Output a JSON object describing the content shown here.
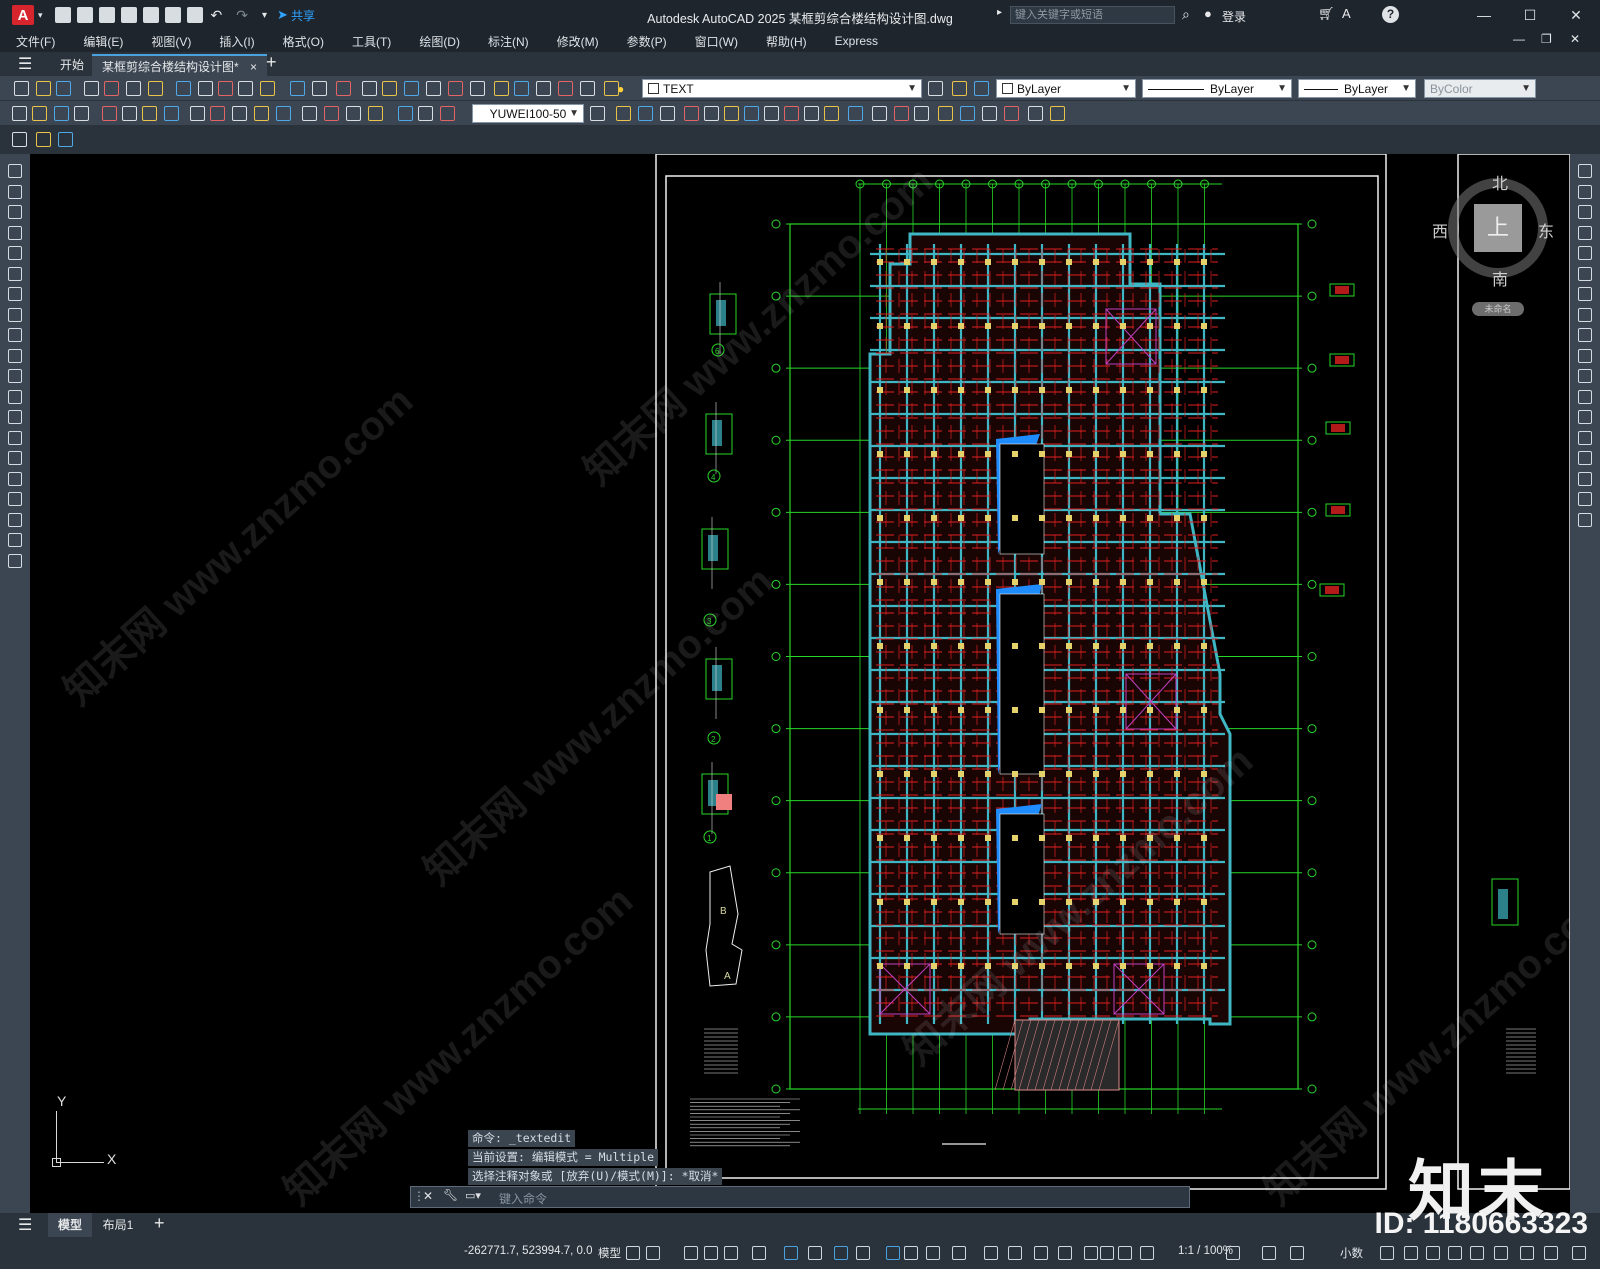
{
  "window": {
    "title": "Autodesk AutoCAD 2025    某框剪综合楼结构设计图.dwg",
    "share_label": "共享",
    "search_placeholder": "键入关键字或短语",
    "login_label": "登录",
    "app_icon_letter": "A"
  },
  "menubar": [
    "文件(F)",
    "编辑(E)",
    "视图(V)",
    "插入(I)",
    "格式(O)",
    "工具(T)",
    "绘图(D)",
    "标注(N)",
    "修改(M)",
    "参数(P)",
    "窗口(W)",
    "帮助(H)",
    "Express"
  ],
  "tabs": {
    "start": "开始",
    "active": "某框剪综合楼结构设计图*",
    "close_glyph": "×",
    "new_glyph": "+"
  },
  "toolbar1": {
    "layer_name": "TEXT",
    "color": "ByLayer",
    "linetype": "ByLayer",
    "lineweight": "ByLayer",
    "plotstyle": "ByColor"
  },
  "toolbar2": {
    "dimstyle": "YUWEI100-50"
  },
  "viewcube": {
    "north": "北",
    "south": "南",
    "east": "东",
    "west": "西",
    "top": "上",
    "wcs": "未命名"
  },
  "ucs": {
    "y": "Y",
    "x": "X"
  },
  "command": {
    "history": [
      "命令: _textedit",
      "当前设置: 编辑模式 = Multiple",
      "选择注释对象或 [放弃(U)/模式(M)]: *取消*"
    ],
    "input_placeholder": "键入命令"
  },
  "layout_tabs": [
    "模型",
    "布局1"
  ],
  "statusbar": {
    "coords": "-262771.7, 523994.7, 0.0",
    "space": "模型",
    "scale": "1:1 / 100%",
    "units": "小数"
  },
  "drawing": {
    "label_a": "A",
    "label_b": "B",
    "detail_numbers": [
      "6",
      "4",
      "3",
      "2",
      "1"
    ]
  },
  "overlay": {
    "id": "ID: 1180663323",
    "brand": "知末",
    "watermark": "知末网 www.znzmo.com"
  },
  "colors": {
    "grid_green": "#27d627",
    "beam_cyan": "#3fb6c4",
    "rebar_red": "#e02020",
    "wall_blue": "#1e8cff",
    "accent_magenta": "#c040c0"
  }
}
